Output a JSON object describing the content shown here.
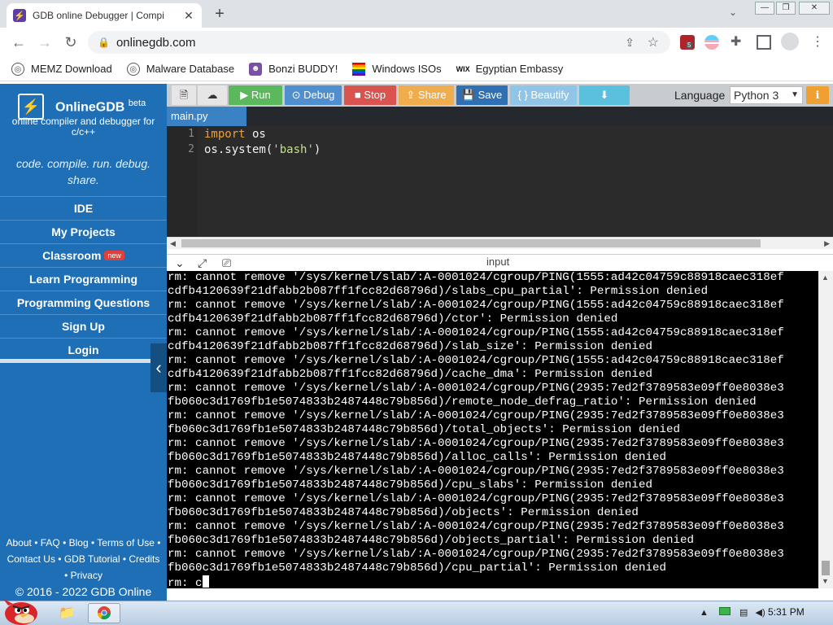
{
  "browser": {
    "tab_title": "GDB online Debugger | Compi",
    "tab_icon": "onlinegdb-favicon",
    "url": "onlinegdb.com",
    "extension_badge": "5"
  },
  "bookmarks": [
    {
      "label": "MEMZ Download",
      "icon": "globe-icon"
    },
    {
      "label": "Malware Database",
      "icon": "globe-icon"
    },
    {
      "label": "Bonzi BUDDY!",
      "icon": "bonzi-icon"
    },
    {
      "label": "Windows ISOs",
      "icon": "rainbow-icon"
    },
    {
      "label": "Egyptian Embassy",
      "icon": "wix-icon"
    }
  ],
  "sidebar": {
    "brand": "OnlineGDB",
    "brand_sup": "beta",
    "subtitle_line1": "online compiler and debugger for",
    "subtitle_line2": "c/c++",
    "tagline_line1": "code. compile. run. debug.",
    "tagline_line2": "share.",
    "items": [
      {
        "label": "IDE"
      },
      {
        "label": "My Projects"
      },
      {
        "label": "Classroom",
        "badge": "new"
      },
      {
        "label": "Learn Programming"
      },
      {
        "label": "Programming Questions"
      },
      {
        "label": "Sign Up"
      },
      {
        "label": "Login"
      }
    ],
    "footer_line1": "About • FAQ • Blog • Terms of Use •",
    "footer_line2": "Contact Us • GDB Tutorial • Credits",
    "footer_line3": "• Privacy",
    "footer_copy": "© 2016 - 2022 GDB Online"
  },
  "toolbar": {
    "run": "Run",
    "debug": "Debug",
    "stop": "Stop",
    "share": "Share",
    "save": "Save",
    "beautify": "{ } Beautify",
    "language_label": "Language",
    "language_value": "Python 3"
  },
  "editor": {
    "file_tab": "main.py",
    "lines": [
      {
        "num": "1",
        "kw": "import",
        "rest": " os"
      },
      {
        "num": "2",
        "pre": "os.system(",
        "str": "'bash'",
        "post": ")"
      }
    ]
  },
  "console": {
    "header": "input",
    "lines": [
      "rm: cannot remove '/sys/kernel/slab/:A-0001024/cgroup/PING(1555:ad42c04759c88918caec318ef",
      "cdfb4120639f21dfabb2b087ff1fcc82d68796d)/slabs_cpu_partial': Permission denied",
      "rm: cannot remove '/sys/kernel/slab/:A-0001024/cgroup/PING(1555:ad42c04759c88918caec318ef",
      "cdfb4120639f21dfabb2b087ff1fcc82d68796d)/ctor': Permission denied",
      "rm: cannot remove '/sys/kernel/slab/:A-0001024/cgroup/PING(1555:ad42c04759c88918caec318ef",
      "cdfb4120639f21dfabb2b087ff1fcc82d68796d)/slab_size': Permission denied",
      "rm: cannot remove '/sys/kernel/slab/:A-0001024/cgroup/PING(1555:ad42c04759c88918caec318ef",
      "cdfb4120639f21dfabb2b087ff1fcc82d68796d)/cache_dma': Permission denied",
      "rm: cannot remove '/sys/kernel/slab/:A-0001024/cgroup/PING(2935:7ed2f3789583e09ff0e8038e3",
      "fb060c3d1769fb1e5074833b2487448c79b856d)/remote_node_defrag_ratio': Permission denied",
      "rm: cannot remove '/sys/kernel/slab/:A-0001024/cgroup/PING(2935:7ed2f3789583e09ff0e8038e3",
      "fb060c3d1769fb1e5074833b2487448c79b856d)/total_objects': Permission denied",
      "rm: cannot remove '/sys/kernel/slab/:A-0001024/cgroup/PING(2935:7ed2f3789583e09ff0e8038e3",
      "fb060c3d1769fb1e5074833b2487448c79b856d)/alloc_calls': Permission denied",
      "rm: cannot remove '/sys/kernel/slab/:A-0001024/cgroup/PING(2935:7ed2f3789583e09ff0e8038e3",
      "fb060c3d1769fb1e5074833b2487448c79b856d)/cpu_slabs': Permission denied",
      "rm: cannot remove '/sys/kernel/slab/:A-0001024/cgroup/PING(2935:7ed2f3789583e09ff0e8038e3",
      "fb060c3d1769fb1e5074833b2487448c79b856d)/objects': Permission denied",
      "rm: cannot remove '/sys/kernel/slab/:A-0001024/cgroup/PING(2935:7ed2f3789583e09ff0e8038e3",
      "fb060c3d1769fb1e5074833b2487448c79b856d)/objects_partial': Permission denied",
      "rm: cannot remove '/sys/kernel/slab/:A-0001024/cgroup/PING(2935:7ed2f3789583e09ff0e8038e3",
      "fb060c3d1769fb1e5074833b2487448c79b856d)/cpu_partial': Permission denied"
    ],
    "last_line": "rm: c"
  },
  "taskbar": {
    "clock": "5:31 PM"
  },
  "colors": {
    "sidebar_bg": "#1e6fb5",
    "run_btn": "#5cb85c",
    "debug_btn": "#4f8fd0",
    "stop_btn": "#d9534f",
    "share_btn": "#f0ad4e",
    "save_btn": "#2f6fb3",
    "beautify_btn": "#5bc0de",
    "download_btn": "#5bc0de"
  }
}
